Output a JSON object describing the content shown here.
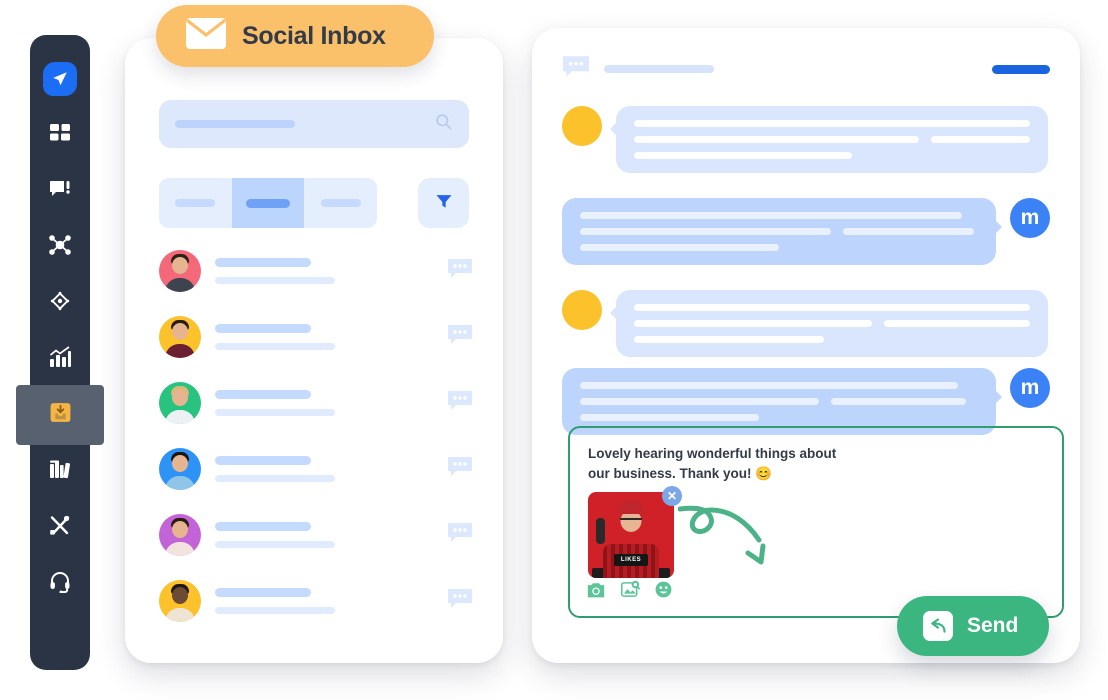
{
  "badge": {
    "title": "Social Inbox",
    "icon": "envelope-icon"
  },
  "sidebar": {
    "background_color": "#2b3445",
    "active_highlight_color": "#58616f",
    "items": [
      {
        "id": "logo",
        "icon": "paper-plane-icon",
        "label": "Logo",
        "active": false,
        "color": "#1b6ef3"
      },
      {
        "id": "dashboard",
        "icon": "grid-icon",
        "label": "Dashboard",
        "active": false,
        "color": "#ffffff"
      },
      {
        "id": "messages",
        "icon": "chat-alert-icon",
        "label": "Messages",
        "active": false,
        "color": "#ffffff"
      },
      {
        "id": "network",
        "icon": "share-nodes-icon",
        "label": "Network",
        "active": false,
        "color": "#ffffff"
      },
      {
        "id": "target",
        "icon": "compass-icon",
        "label": "Discover",
        "active": false,
        "color": "#ffffff"
      },
      {
        "id": "analytics",
        "icon": "bar-chart-icon",
        "label": "Analytics",
        "active": false,
        "color": "#ffffff"
      },
      {
        "id": "inbox",
        "icon": "inbox-icon",
        "label": "Inbox",
        "active": true,
        "color": "#f5b544"
      },
      {
        "id": "library",
        "icon": "books-icon",
        "label": "Library",
        "active": false,
        "color": "#ffffff"
      },
      {
        "id": "tools",
        "icon": "tools-icon",
        "label": "Tools",
        "active": false,
        "color": "#ffffff"
      },
      {
        "id": "support",
        "icon": "headset-icon",
        "label": "Support",
        "active": false,
        "color": "#ffffff"
      }
    ]
  },
  "inbox_panel": {
    "search": {
      "placeholder": "",
      "value": "",
      "icon": "search-icon"
    },
    "tabs": [
      {
        "id": "tab-all",
        "label": "",
        "active": false
      },
      {
        "id": "tab-unread",
        "label": "",
        "active": true
      },
      {
        "id": "tab-assigned",
        "label": "",
        "active": false
      }
    ],
    "filter_button": {
      "icon": "filter-icon",
      "label": "",
      "color": "#2563eb"
    },
    "conversations": [
      {
        "id": "conv-1",
        "avatar_color": "#f4697a",
        "hair": "#2b2119",
        "shirt": "#3d4450",
        "name": "",
        "preview": "",
        "icon": "chat-dots-icon"
      },
      {
        "id": "conv-2",
        "avatar_color": "#fcc22c",
        "hair": "#2a1c14",
        "shirt": "#6b1f33",
        "name": "",
        "preview": "",
        "icon": "chat-dots-icon"
      },
      {
        "id": "conv-3",
        "avatar_color": "#27c37f",
        "hair": "#d8ba78",
        "shirt": "#eef1f4",
        "name": "",
        "preview": "",
        "icon": "chat-dots-icon"
      },
      {
        "id": "conv-4",
        "avatar_color": "#2e93f7",
        "hair": "#1d1711",
        "shirt": "#8fc6e8",
        "name": "",
        "preview": "",
        "icon": "chat-dots-icon"
      },
      {
        "id": "conv-5",
        "avatar_color": "#c264d8",
        "hair": "#2b1b16",
        "shirt": "#f3e3df",
        "name": "",
        "preview": "",
        "icon": "chat-dots-icon"
      },
      {
        "id": "conv-6",
        "avatar_color": "#fcc22c",
        "hair": "#1e1614",
        "shirt": "#efe3d3",
        "name": "",
        "preview": "",
        "icon": "chat-dots-icon"
      }
    ]
  },
  "conversation_panel": {
    "header": {
      "icon": "chat-dots-icon",
      "title": "",
      "action_label": "",
      "action_color": "#1b64e0"
    },
    "messages": [
      {
        "id": "msg-1",
        "direction": "incoming",
        "avatar_color": "#fcc22c",
        "text": "",
        "lines": 3
      },
      {
        "id": "msg-2",
        "direction": "outgoing",
        "avatar_label": "m",
        "avatar_color": "#3b82f6",
        "text": "",
        "lines": 3
      },
      {
        "id": "msg-3",
        "direction": "incoming",
        "avatar_color": "#fcc22c",
        "text": "",
        "lines": 3
      },
      {
        "id": "msg-4",
        "direction": "outgoing",
        "avatar_label": "m",
        "avatar_color": "#3b82f6",
        "text": "",
        "lines": 3
      }
    ],
    "composer": {
      "border_color": "#2f9e6e",
      "text": "Lovely hearing wonderful things about our business. Thank you! 😊",
      "attachment": {
        "alt": "Person in red hat holding LIKES sign",
        "sign_text": "LIKES",
        "remove_icon": "close-circle-icon"
      },
      "toolbar": [
        {
          "id": "camera",
          "icon": "camera-icon",
          "label": ""
        },
        {
          "id": "image-search",
          "icon": "image-search-icon",
          "label": ""
        },
        {
          "id": "emoji",
          "icon": "emoji-icon",
          "label": ""
        }
      ],
      "annotation": {
        "icon": "curved-arrow-icon",
        "color": "#3bb680"
      }
    },
    "send_button": {
      "label": "Send",
      "icon": "reply-arrow-icon",
      "color": "#3bb680"
    }
  }
}
